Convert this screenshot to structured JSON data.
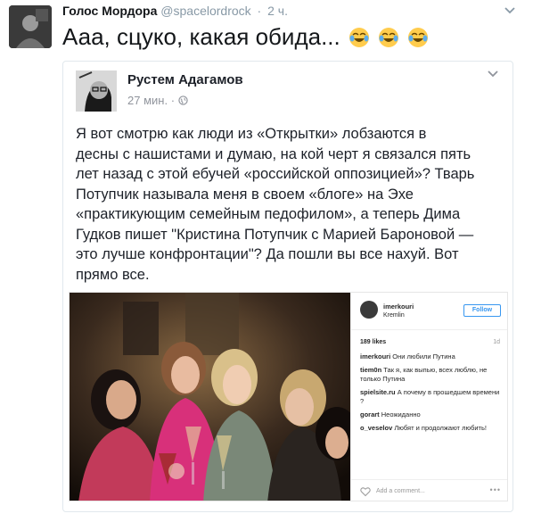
{
  "tweet": {
    "author_name": "Голос Мордора",
    "handle": "@spacelordrock",
    "separator": "·",
    "time": "2 ч.",
    "text": "Ааа, сцуко, какая обида...",
    "emoji": [
      "face-with-tears-of-joy-icon",
      "face-with-tears-of-joy-icon",
      "face-with-tears-of-joy-icon"
    ],
    "caret_icon": "chevron-down-icon"
  },
  "embed": {
    "author_name": "Рустем Адагамов",
    "time": "27 мин.",
    "separator": "·",
    "privacy_icon": "globe-icon",
    "caret_icon": "chevron-down-icon",
    "body_lines": [
      "Я вот смотрю как люди из «Открытки» лобзаются в",
      "десны с нашистами и думаю, на кой черт я связался пять",
      "лет назад с этой ебучей «российской оппозицией»? Тварь",
      "Потупчик называла меня в своем «блоге» на Эхе",
      "«практикующим семейным педофилом», а теперь Дима",
      "Гудков пишет \"Кристина Потупчик с Марией Бароновой —",
      "это лучше конфронтации\"? Да пошли вы все нахуй. Вот",
      "прямо все."
    ]
  },
  "instagram": {
    "username": "imerkouri",
    "location": "Kremlin",
    "follow_label": "Follow",
    "likes": "189 likes",
    "age": "1d",
    "comments": [
      {
        "user": "imerkouri",
        "text": "Они любили Путина"
      },
      {
        "user": "tiem0n",
        "text": "Так я, как выпью, всех люблю, не только Путина"
      },
      {
        "user": "spielsite.ru",
        "text": "А почему в прошедшем времени ?"
      },
      {
        "user": "gorart",
        "text": "Неожиданно"
      },
      {
        "user": "o_veselov",
        "text": "Любят и продолжают любить!"
      }
    ],
    "add_comment_placeholder": "Add a comment...",
    "more_label": "•••",
    "heart_icon": "heart-icon"
  },
  "colors": {
    "text": "#14171a",
    "muted": "#8899a6",
    "border": "#e1e8ed",
    "instagram_blue": "#3897f0",
    "photo_shadow": "#1e1410",
    "photo_warm": "#b88a52"
  }
}
